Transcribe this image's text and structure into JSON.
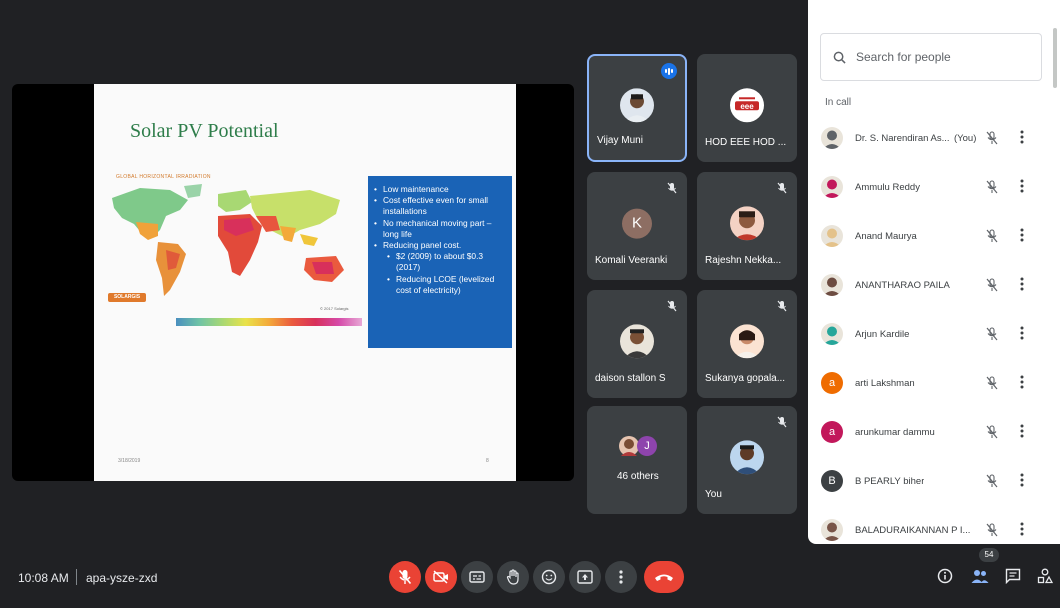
{
  "presentation": {
    "title": "Solar PV Potential",
    "map_caption": "GLOBAL HORIZONTAL IRRADIATION",
    "map_brand": "SOLARGIS",
    "map_credit": "© 2017 Solargis",
    "bullets": [
      {
        "text": "Low maintenance",
        "level": 1
      },
      {
        "text": "Cost effective even for small installations",
        "level": 1
      },
      {
        "text": "No mechanical moving part – long life",
        "level": 1
      },
      {
        "text": "Reducing panel cost.",
        "level": 1
      },
      {
        "text": "$2 (2009) to about $0.3 (2017)",
        "level": 2
      },
      {
        "text": "Reducing LCOE (levelized cost of electricity)",
        "level": 2
      }
    ],
    "footer_date": "3/18/2019",
    "page_number": "8"
  },
  "tiles": [
    {
      "name": "Vijay Muni",
      "avatar": "photo",
      "status": "speaking",
      "active": true
    },
    {
      "name": "HOD EEE HOD ...",
      "avatar": "logo-eee",
      "status": "none",
      "active": false
    },
    {
      "name": "Komali Veeranki",
      "avatar": "K",
      "status": "muted",
      "active": false
    },
    {
      "name": "Rajeshn Nekka...",
      "avatar": "photo",
      "status": "muted",
      "active": false
    },
    {
      "name": "daison stallon S",
      "avatar": "photo",
      "status": "muted",
      "active": false
    },
    {
      "name": "Sukanya gopala...",
      "avatar": "photo",
      "status": "muted",
      "active": false
    },
    {
      "name": "46 others",
      "avatar": "group",
      "status": "none",
      "active": false
    },
    {
      "name": "You",
      "avatar": "photo",
      "status": "muted",
      "active": false
    }
  ],
  "others_avatar_letter": "J",
  "panel": {
    "search_placeholder": "Search for people",
    "section_label": "In call",
    "you_tag": "(You)",
    "people": [
      {
        "name": "Dr. S. Narendiran As...",
        "you": true,
        "avatar": "photo",
        "color": "#5f6368"
      },
      {
        "name": "Ammulu Reddy",
        "you": false,
        "avatar": "photo",
        "color": "#c2185b"
      },
      {
        "name": "Anand Maurya",
        "you": false,
        "avatar": "photo",
        "color": "#e4c28a"
      },
      {
        "name": "ANANTHARAO PAILA",
        "you": false,
        "avatar": "photo",
        "color": "#6d4c41"
      },
      {
        "name": "Arjun Kardile",
        "you": false,
        "avatar": "photo",
        "color": "#26a69a"
      },
      {
        "name": "arti Lakshman",
        "you": false,
        "avatar": "a",
        "color": "#ef6c00"
      },
      {
        "name": "arunkumar dammu",
        "you": false,
        "avatar": "a",
        "color": "#c2185b"
      },
      {
        "name": "B PEARLY biher",
        "you": false,
        "avatar": "B",
        "color": "#3c4043"
      },
      {
        "name": "BALADURAIKANNAN P I...",
        "you": false,
        "avatar": "photo",
        "color": "#795548"
      }
    ]
  },
  "bottom_bar": {
    "time": "10:08 AM",
    "meeting_code": "apa-ysze-zxd",
    "people_count": "54"
  },
  "colors": {
    "background": "#202124",
    "tile": "#3c4043",
    "danger": "#ea4335",
    "accent": "#8ab4f8",
    "slide_blue": "#1a63b6",
    "slide_title_green": "#2e7d4a"
  }
}
